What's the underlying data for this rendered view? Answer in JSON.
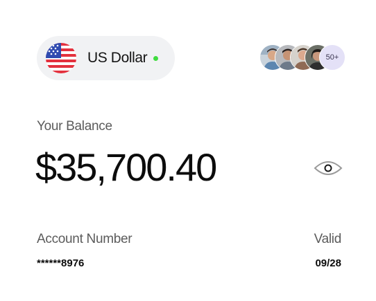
{
  "currency": {
    "flag_icon": "us-flag-icon",
    "label": "US Dollar",
    "status_color": "#3fdc3f"
  },
  "members": {
    "avatars": [
      "avatar-1",
      "avatar-2",
      "avatar-3",
      "avatar-4"
    ],
    "more_label": "50+",
    "more_bg": "#e4e1f7"
  },
  "balance": {
    "label": "Your Balance",
    "amount": "$35,700.40",
    "toggle_icon": "eye-icon"
  },
  "account": {
    "number_label": "Account Number",
    "number_value": "******8976",
    "valid_label": "Valid",
    "valid_value": "09/28"
  }
}
